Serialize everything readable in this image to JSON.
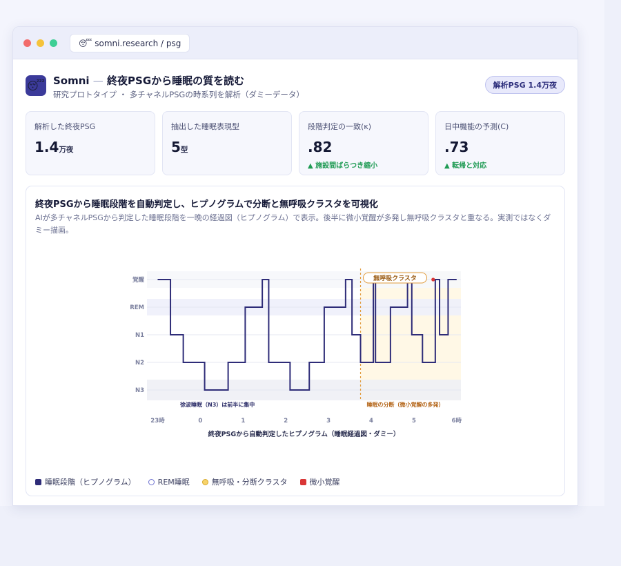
{
  "browser": {
    "url_icon": "sleeping-face-icon",
    "url_icon_glyph": "😴",
    "url": "somni.research / psg"
  },
  "header": {
    "logo_icon": "sleeping-face-icon",
    "logo_glyph": "😴",
    "app_name": "Somni",
    "separator": "—",
    "title": "終夜PSGから睡眠の質を読む",
    "subtitle": "研究プロトタイプ ・ 多チャネルPSGの時系列を解析（ダミーデータ）",
    "badge": "解析PSG 1.4万夜"
  },
  "kpis": [
    {
      "label": "解析した終夜PSG",
      "value": "1.4",
      "unit": "万夜",
      "trend": ""
    },
    {
      "label": "抽出した睡眠表現型",
      "value": "5",
      "unit": "型",
      "trend": ""
    },
    {
      "label": "段階判定の一致(κ)",
      "value": ".82",
      "unit": "",
      "trend": "▲ 施設間ばらつき縮小"
    },
    {
      "label": "日中機能の予測(C)",
      "value": ".73",
      "unit": "",
      "trend": "▲ 転帰と対応"
    }
  ],
  "card": {
    "title": "終夜PSGから睡眠段階を自動判定し、ヒプノグラムで分断と無呼吸クラスタを可視化",
    "description": "AIが多チャネルPSGから判定した睡眠段階を一晩の経過図（ヒプノグラム）で表示。後半に微小覚醒が多発し無呼吸クラスタと重なる。実測ではなくダミー描画。"
  },
  "colors": {
    "accent": "#2e2c78",
    "rem_band": "#eef0fb",
    "n3_band": "#eef0f5",
    "apnea_region": "#fff8e6",
    "apnea_line": "#e19b3c",
    "micro_arousal": "#d93636",
    "trend_up": "#1f9b54"
  },
  "chart_data": {
    "type": "line",
    "subtype": "hypnogram-step",
    "xlabel": "終夜PSGから自動判定したヒプノグラム（睡眠経過図・ダミー）",
    "ylabel": "",
    "y_categories": [
      "覚醒",
      "REM",
      "N1",
      "N2",
      "N3"
    ],
    "x_ticks": [
      {
        "label": "23時",
        "hour": 23
      },
      {
        "label": "0",
        "hour": 24
      },
      {
        "label": "1",
        "hour": 25
      },
      {
        "label": "2",
        "hour": 26
      },
      {
        "label": "3",
        "hour": 27
      },
      {
        "label": "4",
        "hour": 28
      },
      {
        "label": "5",
        "hour": 29
      },
      {
        "label": "6時",
        "hour": 30
      }
    ],
    "xlim": [
      22.75,
      30.1
    ],
    "series": [
      {
        "name": "睡眠段階（ヒプノグラム）",
        "points": [
          [
            23.0,
            "覚醒"
          ],
          [
            23.3,
            "N1"
          ],
          [
            23.6,
            "N2"
          ],
          [
            24.1,
            "N3"
          ],
          [
            24.65,
            "N2"
          ],
          [
            25.05,
            "REM"
          ],
          [
            25.45,
            "覚醒"
          ],
          [
            25.6,
            "N2"
          ],
          [
            26.1,
            "N3"
          ],
          [
            26.55,
            "N2"
          ],
          [
            26.9,
            "REM"
          ],
          [
            27.4,
            "覚醒"
          ],
          [
            27.55,
            "N1"
          ],
          [
            27.75,
            "N2"
          ],
          [
            28.05,
            "覚醒"
          ],
          [
            28.1,
            "N2"
          ],
          [
            28.45,
            "REM"
          ],
          [
            28.85,
            "覚醒"
          ],
          [
            28.95,
            "N1"
          ],
          [
            29.2,
            "N2"
          ],
          [
            29.5,
            "覚醒"
          ],
          [
            29.6,
            "N1"
          ],
          [
            29.8,
            "覚醒"
          ],
          [
            30.0,
            "覚醒"
          ]
        ]
      }
    ],
    "annotations": {
      "sws_note": "徐波睡眠（N3）は前半に集中",
      "late_note": "睡眠の分断（微小覚醒の多発）",
      "apnea_label": "無呼吸クラスタ",
      "apnea_start_hour": 27.75,
      "micro_arousal_hour": 29.45
    },
    "legend": [
      {
        "name": "睡眠段階（ヒプノグラム）",
        "icon": "square"
      },
      {
        "name": "REM睡眠",
        "icon": "circle-outline"
      },
      {
        "name": "無呼吸・分断クラスタ",
        "icon": "circle-yellow"
      },
      {
        "name": "微小覚醒",
        "icon": "square-red"
      }
    ],
    "legend_position": "bottom-left",
    "grid": true
  }
}
